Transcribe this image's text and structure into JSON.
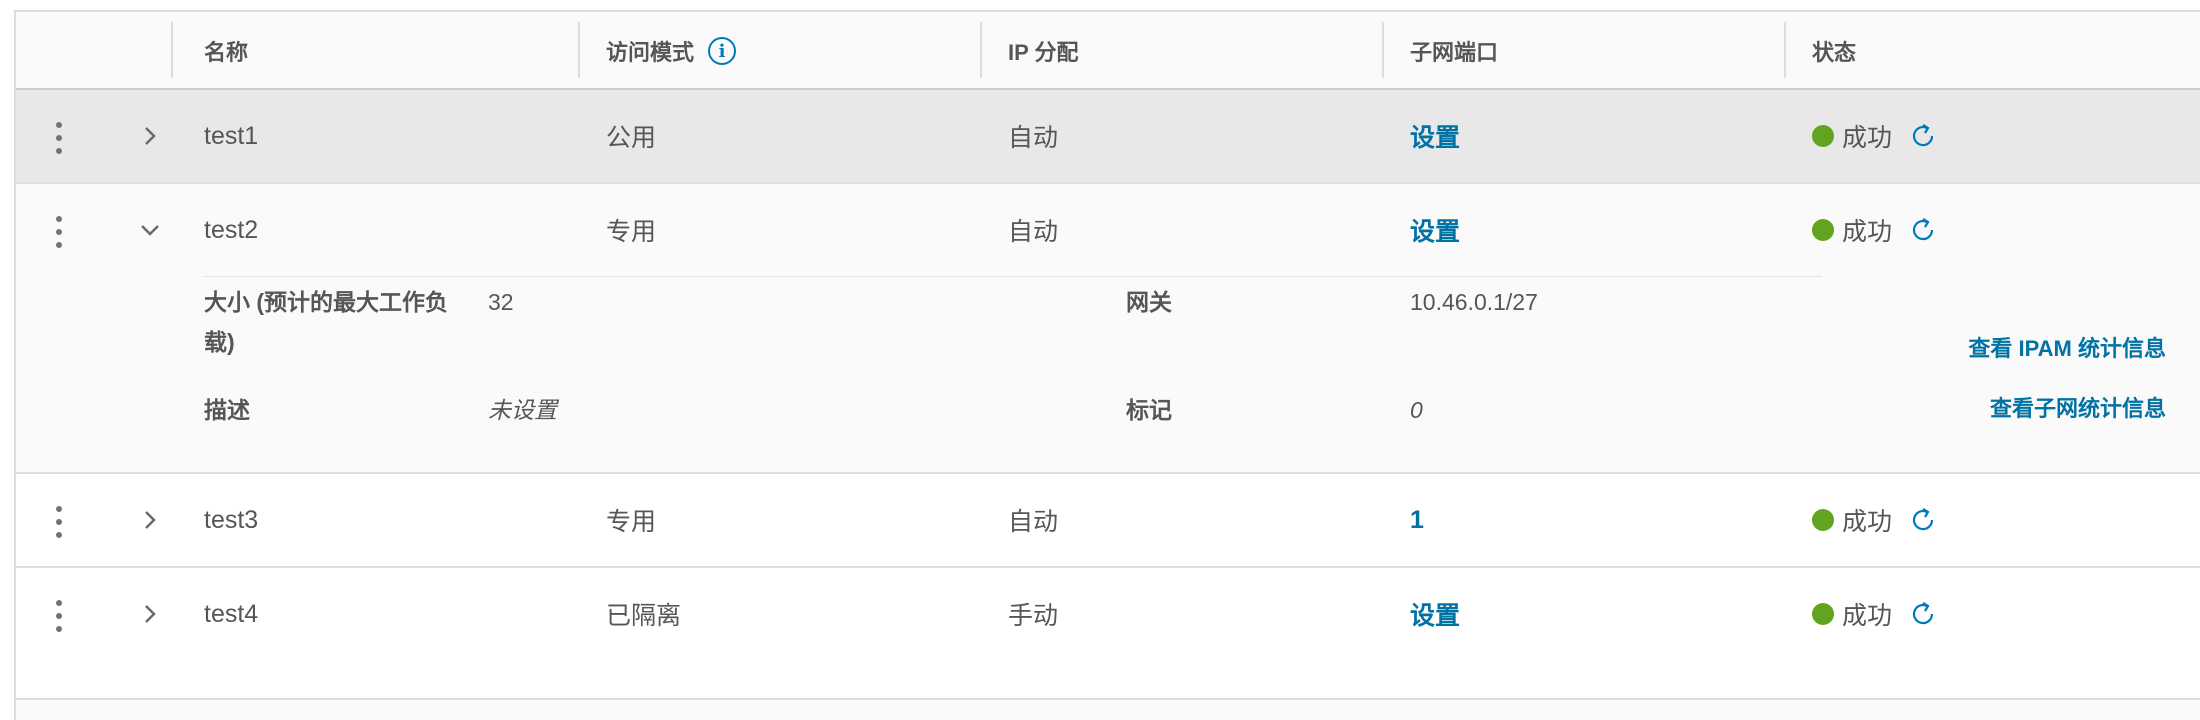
{
  "columns": {
    "name": "名称",
    "access_mode": "访问模式",
    "ip_allocation": "IP 分配",
    "subnet_port": "子网端口",
    "status": "状态"
  },
  "rows": [
    {
      "name": "test1",
      "access_mode": "公用",
      "ip_allocation": "自动",
      "subnet_port": "设置",
      "status": "成功",
      "expanded": false,
      "selected": true
    },
    {
      "name": "test2",
      "access_mode": "专用",
      "ip_allocation": "自动",
      "subnet_port": "设置",
      "status": "成功",
      "expanded": true,
      "selected": false
    },
    {
      "name": "test3",
      "access_mode": "专用",
      "ip_allocation": "自动",
      "subnet_port": "1",
      "status": "成功",
      "expanded": false,
      "selected": false
    },
    {
      "name": "test4",
      "access_mode": "已隔离",
      "ip_allocation": "手动",
      "subnet_port": "设置",
      "status": "成功",
      "expanded": false,
      "selected": false
    }
  ],
  "detail": {
    "size_label": "大小 (预计的最大工作负载)",
    "size_value": "32",
    "gateway_label": "网关",
    "gateway_value": "10.46.0.1/27",
    "description_label": "描述",
    "description_value": "未设置",
    "tags_label": "标记",
    "tags_value": "0",
    "view_ipam_link": "查看 IPAM 统计信息",
    "view_subnet_link": "查看子网统计信息"
  },
  "colors": {
    "link": "#0072a3",
    "success": "#62a420",
    "selected_row": "#e8e8e8"
  },
  "icons": {
    "row_menu": "vertical-dots-icon",
    "expand": "chevron-right-icon",
    "collapse": "chevron-down-icon",
    "info": "info-circle-icon",
    "refresh": "refresh-icon",
    "status": "status-dot-icon"
  }
}
